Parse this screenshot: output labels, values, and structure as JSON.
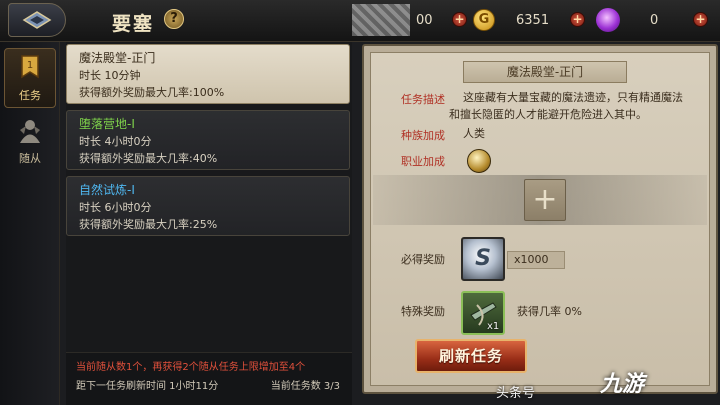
{
  "header": {
    "title": "要塞",
    "help_label": "?",
    "resources": [
      {
        "name": "stamina",
        "value": "00",
        "icon": "blurred-resource-icon"
      },
      {
        "name": "gold",
        "value": "6351",
        "icon": "gold-coin-icon",
        "glyph": "G"
      },
      {
        "name": "gem",
        "value": "0",
        "icon": "purple-gem-icon"
      }
    ],
    "plus_label": "+"
  },
  "side_tabs": [
    {
      "label": "任务",
      "icon": "quest-banner-icon",
      "active": true
    },
    {
      "label": "随从",
      "icon": "follower-icon",
      "active": false
    }
  ],
  "quests": [
    {
      "name": "魔法殿堂-正门",
      "duration": "时长 10分钟",
      "bonus": "获得额外奖励最大几率:100%",
      "name_color": "#3a2d1c",
      "selected": true
    },
    {
      "name": "堕落营地-I",
      "duration": "时长 4小时0分",
      "bonus": "获得额外奖励最大几率:40%",
      "name_color": "#7fd34b",
      "selected": false
    },
    {
      "name": "自然试炼-I",
      "duration": "时长 6小时0分",
      "bonus": "获得额外奖励最大几率:25%",
      "name_color": "#4fb6ef",
      "selected": false
    }
  ],
  "footer": {
    "notice": "当前随从数1个，再获得2个随从任务上限增加至4个",
    "refresh_time": "距下一任务刷新时间 1小时11分",
    "quest_count": "当前任务数 3/3"
  },
  "detail": {
    "title": "魔法殿堂-正门",
    "desc_label": "任务描述",
    "desc_line1": "这座藏有大量宝藏的魔法遗迹，只有精通魔法",
    "desc_line2": "和擅长隐匿的人才能避开危险进入其中。",
    "race_label": "种族加成",
    "race_value": "人类",
    "class_label": "职业加成",
    "class_icon": "class-emblem-icon",
    "add_label": "+",
    "reward_label": "必得奖励",
    "reward_icon": "silver-coin-icon",
    "reward_glyph": "S",
    "reward_qty": "x1000",
    "special_label": "特殊奖励",
    "special_icon": "crossbow-gear-icon",
    "special_qty": "x1",
    "special_chance": "获得几率 0%",
    "refresh_button": "刷新任务"
  },
  "watermarks": {
    "toutiao": "头条号",
    "logo": "九游"
  }
}
